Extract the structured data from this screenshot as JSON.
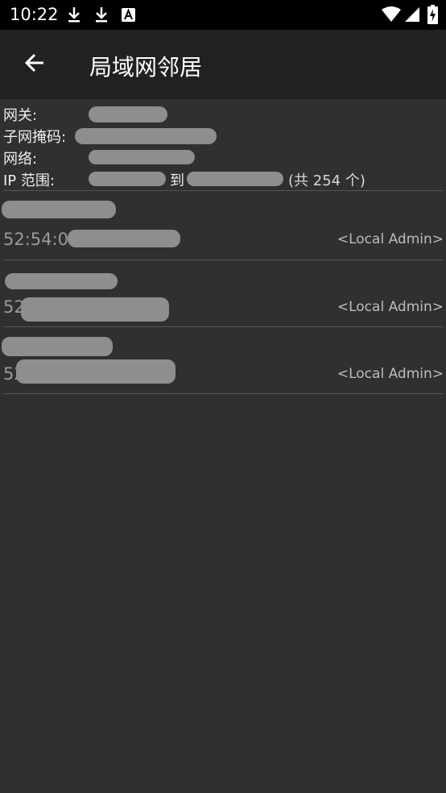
{
  "status_bar": {
    "time": "10:22",
    "left_icons": [
      "download-icon",
      "download-icon",
      "text-a-icon"
    ],
    "right_icons": [
      "wifi-icon",
      "signal-icon",
      "battery-icon"
    ]
  },
  "app_bar": {
    "title": "局域网邻居",
    "back_icon": "arrow-back-icon"
  },
  "network_info": {
    "gateway_label": "网关:",
    "gateway_value": "",
    "subnet_label": "子网掩码:",
    "subnet_value": "",
    "network_label": "网络:",
    "network_value": "",
    "ip_range_label": "IP 范围:",
    "ip_range_to": "到",
    "ip_range_count": "(共 254 个)"
  },
  "hosts": [
    {
      "ip": "",
      "mac": "52:54:00",
      "vendor": "<Local Admin>"
    },
    {
      "ip": "",
      "mac": "52",
      "vendor": "<Local Admin>"
    },
    {
      "ip": "",
      "mac": "52",
      "vendor": "<Local Admin>"
    }
  ],
  "colors": {
    "background": "#303030",
    "app_bar": "#212121",
    "status_bar": "#000000",
    "divider": "#555555"
  }
}
